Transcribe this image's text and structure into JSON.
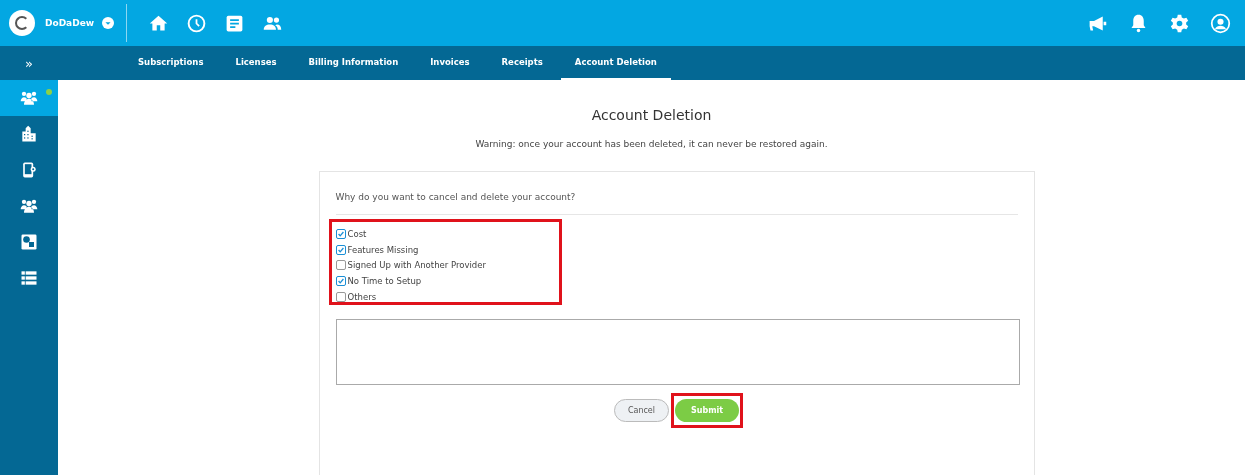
{
  "brand": {
    "name": "DoDaDew"
  },
  "top_nav": [
    {
      "kind": "home"
    },
    {
      "kind": "clock"
    },
    {
      "kind": "document"
    },
    {
      "kind": "people"
    }
  ],
  "top_actions": [
    {
      "kind": "megaphone"
    },
    {
      "kind": "bell"
    },
    {
      "kind": "settings"
    },
    {
      "kind": "account"
    }
  ],
  "sidebar": {
    "toggle": "»",
    "items": [
      {
        "kind": "team",
        "selected": true,
        "online": true
      },
      {
        "kind": "building",
        "selected": false,
        "online": false
      },
      {
        "kind": "device",
        "selected": false,
        "online": false
      },
      {
        "kind": "team",
        "selected": false,
        "online": false
      },
      {
        "kind": "tile",
        "selected": false,
        "online": false
      },
      {
        "kind": "list",
        "selected": false,
        "online": false
      }
    ]
  },
  "tabs": [
    {
      "label": "Subscriptions",
      "selected": false
    },
    {
      "label": "Licenses",
      "selected": false
    },
    {
      "label": "Billing Information",
      "selected": false
    },
    {
      "label": "Invoices",
      "selected": false
    },
    {
      "label": "Receipts",
      "selected": false
    },
    {
      "label": "Account Deletion",
      "selected": true
    }
  ],
  "page": {
    "title": "Account Deletion",
    "warning": "Warning: once your account has been deleted, it can never be restored again."
  },
  "form": {
    "question": "Why do you want to cancel and delete your account?",
    "reasons": [
      {
        "label": "Cost",
        "checked": true
      },
      {
        "label": "Features Missing",
        "checked": true
      },
      {
        "label": "Signed Up with Another Provider",
        "checked": false
      },
      {
        "label": "No Time to Setup",
        "checked": true
      },
      {
        "label": "Others",
        "checked": false
      }
    ],
    "buttons": [
      {
        "label": "Cancel",
        "kind": "secondary"
      },
      {
        "label": "Submit",
        "kind": "primary"
      }
    ]
  }
}
